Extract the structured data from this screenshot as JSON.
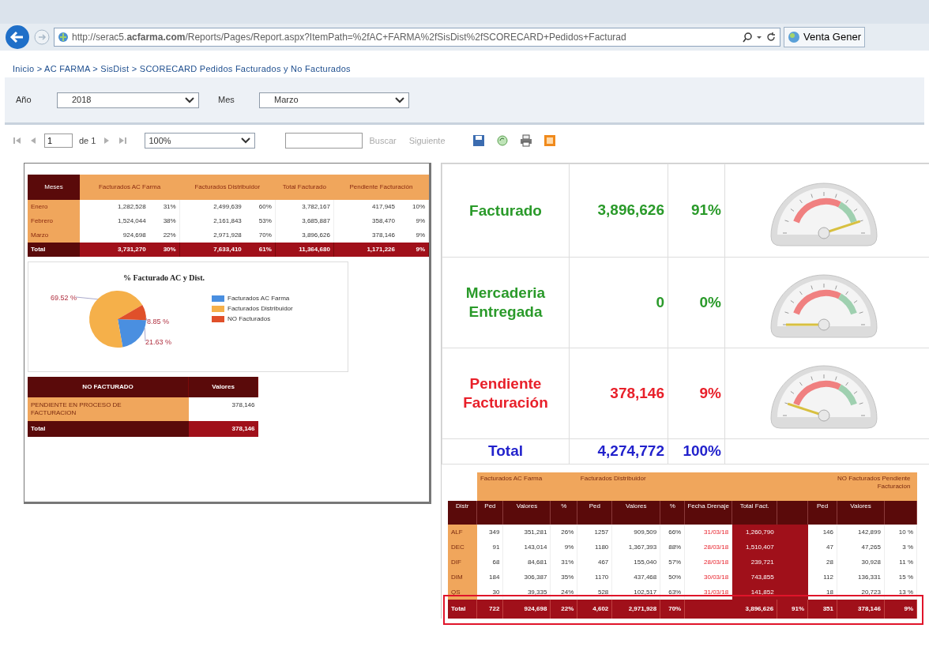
{
  "browser": {
    "url": "http://serac5.**acfarma.com**/Reports/Pages/Report.aspx?ItemPath=%2fAC+FARMA%2fSisDist%2fSCORECARD+Pedidos+Facturad",
    "tab_title": "Venta Gener"
  },
  "breadcrumb": "Inicio > AC FARMA > SisDist > SCORECARD Pedidos Facturados y No Facturados",
  "parameters": [
    {
      "label": "Año",
      "value": "2018"
    },
    {
      "label": "Mes",
      "value": "Marzo"
    }
  ],
  "toolbar": {
    "page": "1",
    "of_label": "de 1",
    "zoom": "100%",
    "find_label": "Buscar",
    "next_label": "Siguiente"
  },
  "months_table": {
    "columns": [
      "Meses",
      "Facturados AC Farma",
      "Facturados Distribuidor",
      "Total Facturado",
      "Pendiente Facturación"
    ],
    "rows": [
      {
        "cells": [
          {
            "value": "Enero"
          },
          {
            "value": "1,282,528",
            "percent": "31%"
          },
          {
            "value": "2,499,639",
            "percent": "60%"
          },
          {
            "value": "3,782,167"
          },
          {
            "value": "417,945",
            "percent": "10%"
          }
        ]
      },
      {
        "cells": [
          {
            "value": "Febrero"
          },
          {
            "value": "1,524,044",
            "percent": "38%"
          },
          {
            "value": "2,161,843",
            "percent": "53%"
          },
          {
            "value": "3,685,887"
          },
          {
            "value": "358,470",
            "percent": "9%"
          }
        ]
      },
      {
        "cells": [
          {
            "value": "Marzo"
          },
          {
            "value": "924,698",
            "percent": "22%"
          },
          {
            "value": "2,971,928",
            "percent": "70%"
          },
          {
            "value": "3,896,626"
          },
          {
            "value": "378,146",
            "percent": "9%"
          }
        ]
      }
    ],
    "total": {
      "cells": [
        {
          "value": "Total"
        },
        {
          "value": "3,731,270",
          "percent": "30%"
        },
        {
          "value": "7,633,410",
          "percent": "61%"
        },
        {
          "value": "11,364,680"
        },
        {
          "value": "1,171,226",
          "percent": "9%"
        }
      ]
    }
  },
  "pie": {
    "chart_data": {
      "type": "pie",
      "title": "% Facturado AC y Dist.",
      "categories": [
        "Facturados AC Farma",
        "Facturados Distribuidor",
        "NO Facturados"
      ],
      "values": [
        21.63,
        69.52,
        8.85
      ],
      "colors": [
        "#4a8fe0",
        "#f5b04a",
        "#e0502a"
      ],
      "legend": "right",
      "value_labels": [
        "21.63 %",
        "69.52 %",
        "8.85 %"
      ]
    }
  },
  "no_facturado": {
    "columns": [
      "NO FACTURADO",
      "Valores"
    ],
    "rows": [
      [
        "PENDIENTE EN PROCESO DE FACTURACION",
        "378,146"
      ]
    ],
    "total": [
      "Total",
      "378,146"
    ]
  },
  "scorecard": {
    "rows": [
      {
        "label": "Facturado",
        "value": "3,896,626",
        "percent": "91%",
        "color": "#2a9a2a"
      },
      {
        "label": "Mercaderia Entregada",
        "value": "0",
        "percent": "0%",
        "color": "#2a9a2a"
      },
      {
        "label": "Pendiente Facturación",
        "value": "378,146",
        "percent": "9%",
        "color": "#e8202a"
      }
    ],
    "total": {
      "label": "Total",
      "value": "4,274,772",
      "percent": "100%",
      "color": "#2222cc"
    }
  },
  "distributors": {
    "group_headers": [
      "Facturados AC Farma",
      "Facturados Distribuidor",
      "NO Facturados Pendiente Facturacion"
    ],
    "columns": [
      "Distr",
      "Ped",
      "Valores",
      "%",
      "Ped",
      "Valores",
      "%",
      "Fecha Drenaje",
      "Total Fact.",
      "Ped",
      "Valores"
    ],
    "rows": [
      [
        "ALF",
        "349",
        "351,281",
        "26%",
        "1257",
        "909,509",
        "66%",
        "31/03/18",
        "1,260,790",
        "146",
        "142,899",
        "10 %"
      ],
      [
        "DEC",
        "91",
        "143,014",
        "9%",
        "1180",
        "1,367,393",
        "88%",
        "28/03/18",
        "1,510,407",
        "47",
        "47,265",
        "3 %"
      ],
      [
        "DIF",
        "68",
        "84,681",
        "31%",
        "467",
        "155,040",
        "57%",
        "28/03/18",
        "239,721",
        "28",
        "30,928",
        "11 %"
      ],
      [
        "DIM",
        "184",
        "306,387",
        "35%",
        "1170",
        "437,468",
        "50%",
        "30/03/18",
        "743,855",
        "112",
        "136,331",
        "15 %"
      ],
      [
        "QS",
        "30",
        "39,335",
        "24%",
        "528",
        "102,517",
        "63%",
        "31/03/18",
        "141,852",
        "18",
        "20,723",
        "13 %"
      ]
    ],
    "total": [
      "Total",
      "722",
      "924,698",
      "22%",
      "4,602",
      "2,971,928",
      "70%",
      "3,896,626",
      "91%",
      "351",
      "378,146",
      "9%"
    ],
    "highlighted": true
  }
}
